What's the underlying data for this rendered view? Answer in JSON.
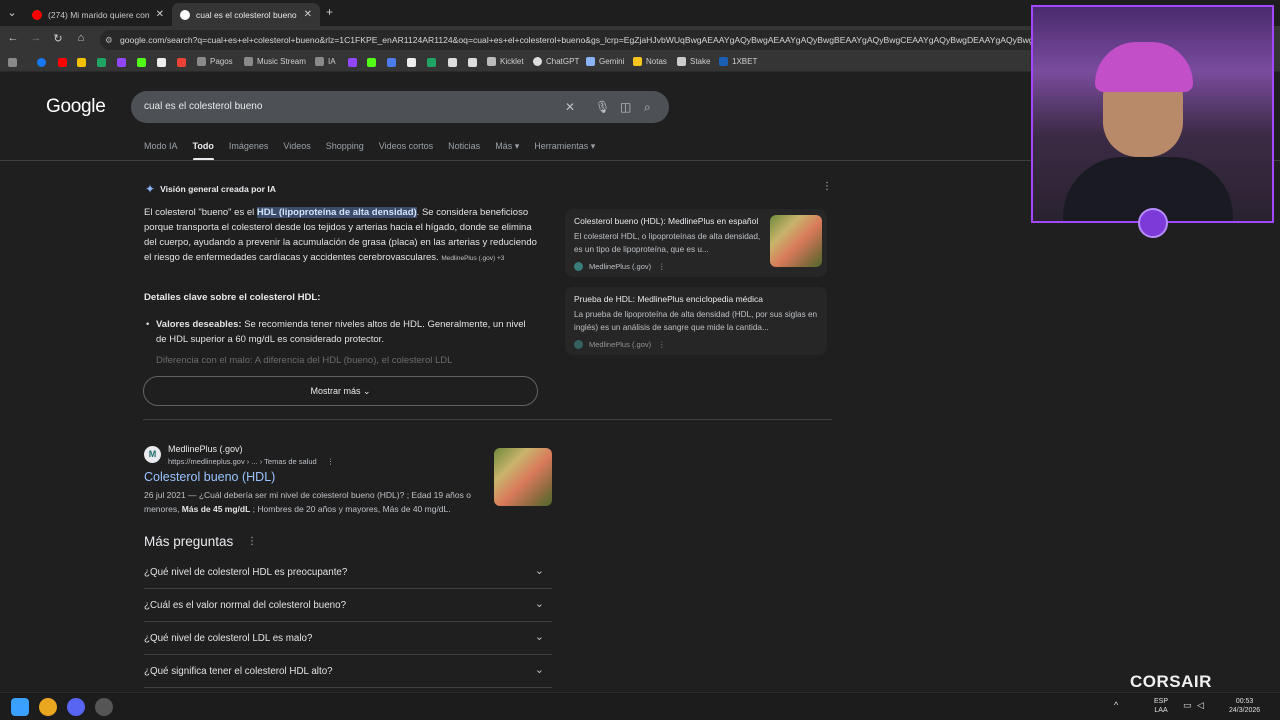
{
  "browser": {
    "tabs": [
      {
        "title": "(274) Mi marido quiere conver",
        "active": false
      },
      {
        "title": "cual es el colesterol bueno - Bu",
        "active": true
      }
    ],
    "new_tab": "+",
    "url": "google.com/search?q=cual+es+el+colesterol+bueno&rlz=1C1FKPE_enAR1124AR1124&oq=cual+es+el+colesterol+bueno&gs_lcrp=EgZjaHJvbWUqBwgAEAAYgAQyBwgAEAAYgAQyBwgBEAAYgAQyBwgCEAAYgAQyBwgDEAAYgAQyBwgE",
    "bookmarks": [
      "Pagos",
      "Music Stream",
      "IA",
      "Kicklet",
      "ChatGPT",
      "Gemini",
      "Notas",
      "Stake",
      "1XBET"
    ]
  },
  "google": {
    "logo": "Google",
    "query": "cual es el colesterol bueno",
    "tabs": [
      "Modo IA",
      "Todo",
      "Imágenes",
      "Videos",
      "Shopping",
      "Videos cortos",
      "Noticias",
      "Más ▾",
      "Herramientas ▾"
    ],
    "selected_tab": "Todo"
  },
  "ai_overview": {
    "heading": "Visión general creada por IA",
    "para_pre": "El colesterol \"bueno\" es el ",
    "para_highlight": "HDL (lipoproteína de alta densidad)",
    "para_post": ". Se considera beneficioso porque transporta el colesterol desde los tejidos y arterias hacia el hígado, donde se elimina del cuerpo, ayudando a prevenir la acumulación de grasa (placa) en las arterias y reduciendo el riesgo de enfermedades cardíacas y accidentes cerebrovasculares.",
    "source_chip": "MedlinePlus (.gov) +3",
    "details_title": "Detalles clave sobre el colesterol HDL:",
    "bullet1_label": "Valores deseables:",
    "bullet1_text": " Se recomienda tener niveles altos de HDL. Generalmente, un nivel de HDL superior a 60 mg/dL es considerado protector.",
    "bullet2_text": "Diferencia con el malo: A diferencia del HDL (bueno), el colesterol LDL",
    "show_more": "Mostrar más ⌄"
  },
  "source_cards": [
    {
      "title": "Colesterol bueno (HDL): MedlinePlus en español",
      "desc": "El colesterol HDL, o lipoproteínas de alta densidad, es un tipo de lipoproteína, que es u...",
      "source": "MedlinePlus (.gov)"
    },
    {
      "title": "Prueba de HDL: MedlinePlus enciclopedia médica",
      "desc": "La prueba de lipoproteína de alta densidad (HDL, por sus siglas en inglés) es un análisis de sangre que mide la cantida...",
      "source": "MedlinePlus (.gov)"
    }
  ],
  "result": {
    "site": "MedlinePlus (.gov)",
    "url": "https://medlineplus.gov › ... › Temas de salud",
    "title": "Colesterol bueno (HDL)",
    "date": "26 jul 2021 — ",
    "snippet_a": "¿Cuál debería ser mi nivel de colesterol bueno (HDL)? ; Edad 19 años o menores, ",
    "snippet_bold": "Más de 45 mg/dL",
    "snippet_b": " ; Hombres de 20 años y mayores, Más de 40 mg/dL."
  },
  "people_ask": {
    "title": "Más preguntas",
    "questions": [
      "¿Qué nivel de colesterol HDL es preocupante?",
      "¿Cuál es el valor normal del colesterol bueno?",
      "¿Qué nivel de colesterol LDL es malo?",
      "¿Qué significa tener el colesterol HDL alto?"
    ]
  },
  "overlay": {
    "brand": "CORSAIR"
  },
  "taskbar": {
    "lang": "ESP",
    "region": "LAA",
    "time": "00:53",
    "date": "24/3/2026"
  },
  "colors": {
    "link": "#99c3ff",
    "highlight": "#3b4d6b",
    "accent": "#8ab4f8",
    "cam_border": "#a347ff"
  }
}
